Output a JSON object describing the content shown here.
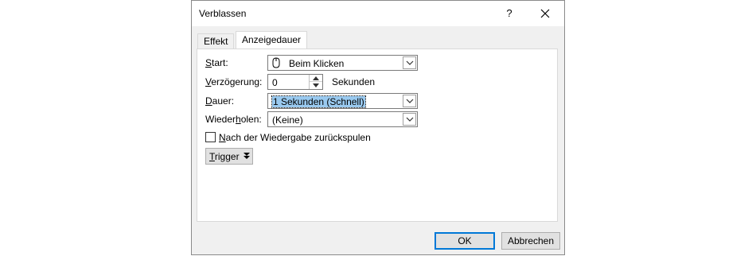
{
  "window": {
    "title": "Verblassen",
    "help_label": "?"
  },
  "tabs": [
    {
      "label": "Effekt",
      "active": false
    },
    {
      "label": "Anzeigedauer",
      "active": true
    }
  ],
  "fields": {
    "start": {
      "label": "Start:",
      "value": "Beim Klicken",
      "icon": "mouse-icon"
    },
    "delay": {
      "label": "Verzögerung:",
      "value": "0",
      "unit": "Sekunden"
    },
    "duration": {
      "label": "Dauer:",
      "value": "1 Sekunden (Schnell)"
    },
    "repeat": {
      "label": "Wiederholen:",
      "value": "(Keine)"
    }
  },
  "rewind": {
    "label": "Nach der Wiedergabe zurückspulen",
    "checked": false
  },
  "trigger": {
    "label": "Trigger"
  },
  "buttons": {
    "ok": "OK",
    "cancel": "Abbrechen"
  },
  "colors": {
    "selection": "#99c9ef",
    "default_button_border": "#0078d7",
    "dialog_bg": "#f0f0f0"
  }
}
